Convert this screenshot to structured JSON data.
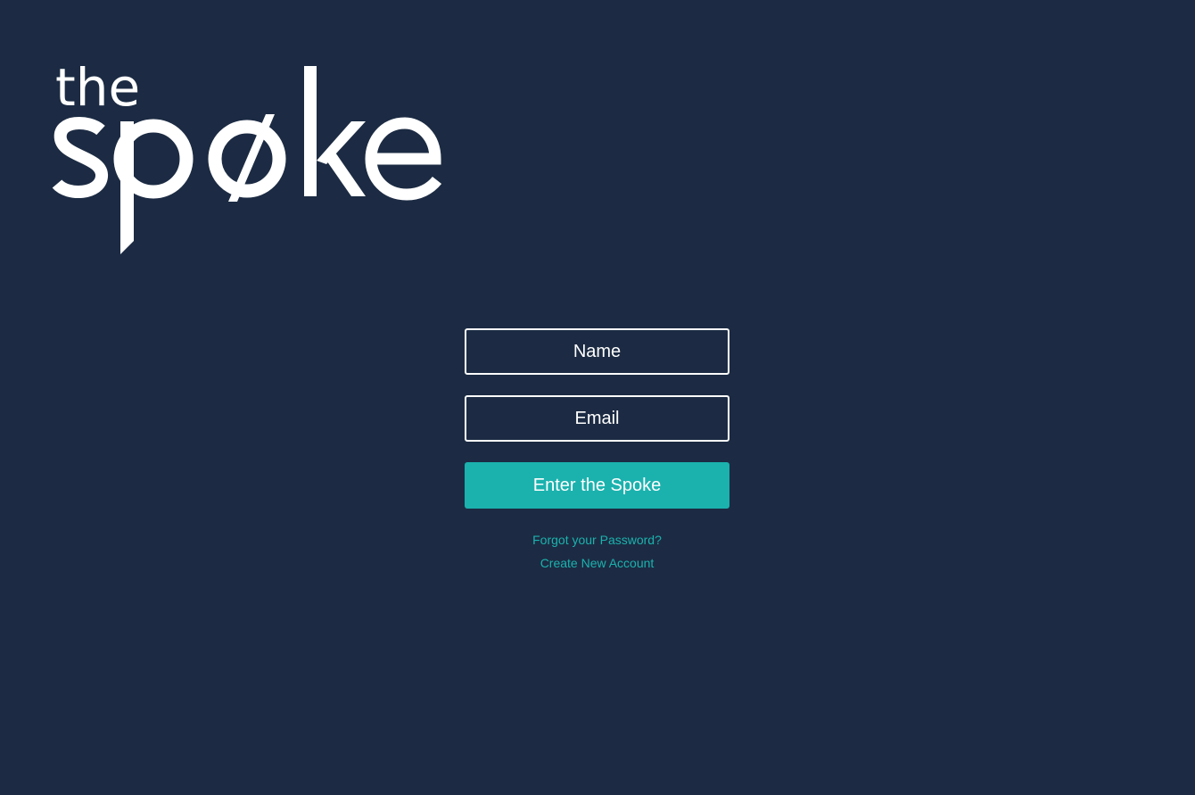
{
  "logo": {
    "line1": "the",
    "line2": "spøke"
  },
  "form": {
    "name_placeholder": "Name",
    "email_placeholder": "Email",
    "submit_label": "Enter the Spoke"
  },
  "links": {
    "forgot_password": "Forgot your Password?",
    "create_account": "Create New Account"
  },
  "colors": {
    "background": "#1c2b43",
    "accent": "#1bb2ae",
    "text": "#ffffff"
  }
}
